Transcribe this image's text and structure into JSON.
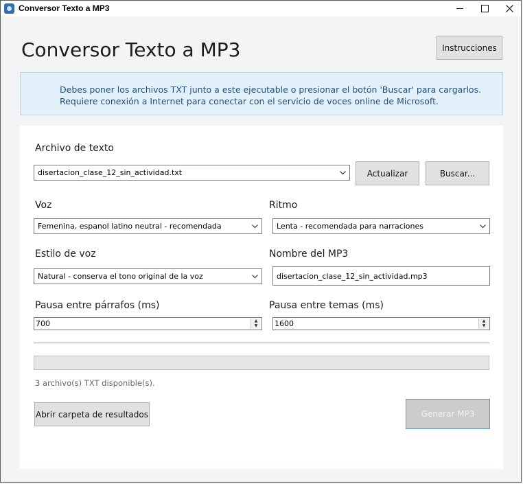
{
  "window": {
    "title": "Conversor Texto a MP3",
    "controls": {
      "minimize": "minimize",
      "maximize": "maximize",
      "close": "close"
    }
  },
  "header": {
    "title": "Conversor Texto a MP3",
    "instructions_button": "Instrucciones"
  },
  "info": {
    "line1": "Debes poner los archivos TXT junto a este ejecutable o presionar el botón 'Buscar' para cargarlos.",
    "line2": "Requiere conexión a Internet para conectar con el servicio de voces online de Microsoft."
  },
  "form": {
    "file": {
      "label": "Archivo de texto",
      "value": "disertacion_clase_12_sin_actividad.txt",
      "refresh_button": "Actualizar",
      "browse_button": "Buscar..."
    },
    "voice": {
      "label": "Voz",
      "value": "Femenina, espanol latino neutral - recomendada"
    },
    "rhythm": {
      "label": "Ritmo",
      "value": "Lenta - recomendada para narraciones"
    },
    "style": {
      "label": "Estilo de voz",
      "value": "Natural - conserva el tono original de la voz"
    },
    "mp3_name": {
      "label": "Nombre del MP3",
      "value": "disertacion_clase_12_sin_actividad.mp3"
    },
    "paragraph_pause": {
      "label": "Pausa entre párrafos (ms)",
      "value": "700"
    },
    "topic_pause": {
      "label": "Pausa entre temas (ms)",
      "value": "1600"
    }
  },
  "progress": {
    "percent": 0
  },
  "status": {
    "text": "3 archivo(s) TXT disponible(s)."
  },
  "actions": {
    "open_folder": "Abrir carpeta de resultados",
    "generate": "Generar MP3"
  },
  "colors": {
    "info_background": "#e3f1fa",
    "info_text": "#1f4f7a",
    "generate_border": "#5b9bd5"
  },
  "icons": [
    "app-icon",
    "chevron-down-icon",
    "spin-up-icon",
    "spin-down-icon"
  ]
}
